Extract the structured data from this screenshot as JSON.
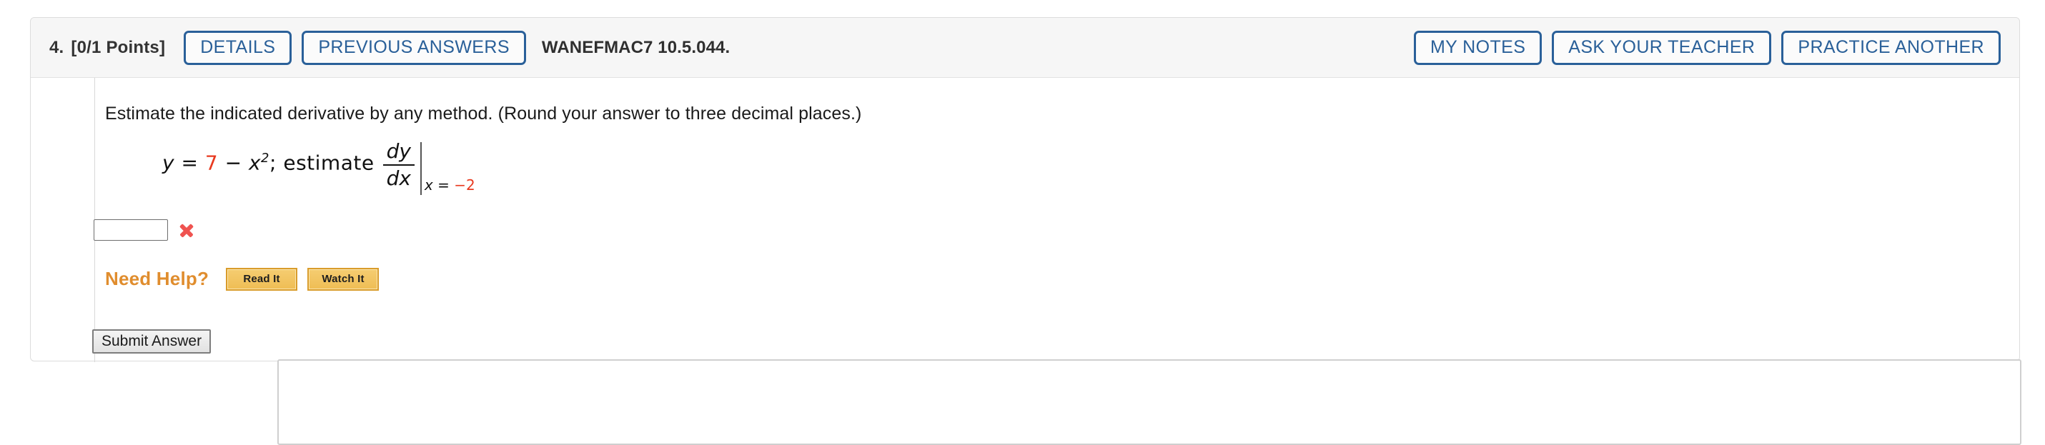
{
  "header": {
    "question_number": "4.",
    "points": "[0/1 Points]",
    "details_label": "DETAILS",
    "previous_answers_label": "PREVIOUS ANSWERS",
    "assignment_code": "WANEFMAC7 10.5.044.",
    "my_notes_label": "MY NOTES",
    "ask_your_teacher_label": "ASK YOUR TEACHER",
    "practice_another_label": "PRACTICE ANOTHER"
  },
  "question": {
    "prompt": "Estimate the indicated derivative by any method. (Round your answer to three decimal places.)",
    "math": {
      "lhs_var": "y",
      "equals": "=",
      "constant": "7",
      "minus": "−",
      "term_var": "x",
      "term_exponent": "2",
      "semicolon": ";",
      "estimate_word": "estimate",
      "numerator": "dy",
      "denominator": "dx",
      "eval_var": "x",
      "eval_equals": "=",
      "eval_value": "−2"
    }
  },
  "answer": {
    "value": "",
    "placeholder": "",
    "status": "incorrect",
    "status_icon": "red-x-icon"
  },
  "need_help": {
    "label": "Need Help?",
    "read_it_label": "Read It",
    "watch_it_label": "Watch It"
  },
  "actions": {
    "submit_label": "Submit Answer"
  },
  "colors": {
    "link_blue": "#2a6099",
    "need_help_orange": "#e08d2e",
    "math_red": "#e8391f",
    "incorrect_red": "#ef5350",
    "help_button_gold": "#efbe55",
    "header_background": "#f6f6f6"
  }
}
